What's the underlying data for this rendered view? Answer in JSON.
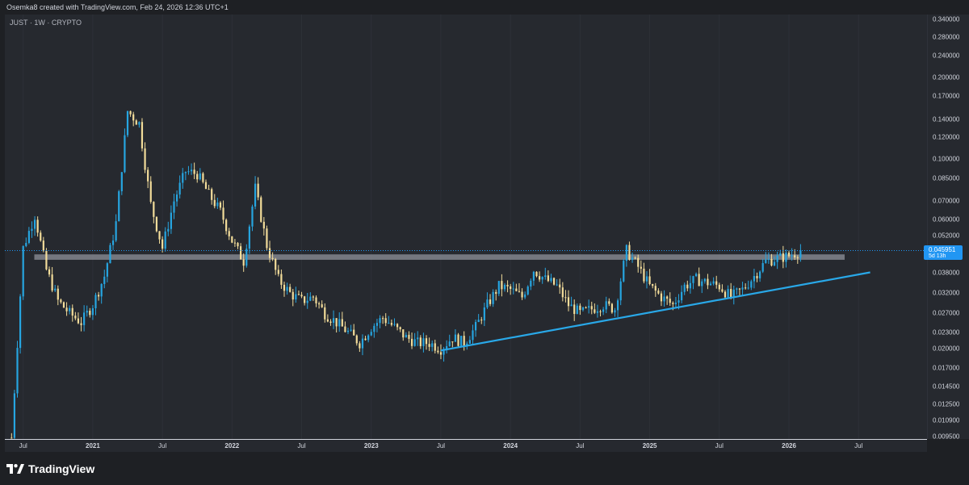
{
  "header": {
    "text": "Osemka8 created with TradingView.com, Feb 24, 2026 12:36 UTC+1"
  },
  "chart": {
    "symbol_label": "JUST · 1W · CRYPTO",
    "colors": {
      "up": "#26a5e0",
      "down": "#f2dc9a",
      "resistance_zone": "#9598a1",
      "trendline": "#29a8e8",
      "price_line": "#2196f3"
    },
    "price_badge": {
      "value": "0.045951",
      "countdown": "5d 13h"
    }
  },
  "price_axis": {
    "ticks": [
      "0.340000",
      "0.280000",
      "0.240000",
      "0.200000",
      "0.170000",
      "0.140000",
      "0.120000",
      "0.100000",
      "0.085000",
      "0.070000",
      "0.060000",
      "0.052000",
      "0.038000",
      "0.032000",
      "0.027000",
      "0.023000",
      "0.020000",
      "0.017000",
      "0.014500",
      "0.012500",
      "0.010900",
      "0.009500"
    ]
  },
  "time_axis": {
    "ticks": [
      "Jul",
      "2021",
      "Jul",
      "2022",
      "Jul",
      "2023",
      "Jul",
      "2024",
      "Jul",
      "2025",
      "Jul",
      "2026",
      "Jul"
    ]
  },
  "footer": {
    "logo_text": "TradingView",
    "logo_icon": "tradingview-logo-icon"
  },
  "chart_data": {
    "type": "candlestick",
    "title": "JUST · 1W · CRYPTO",
    "scale": "log",
    "ylim": [
      0.0093,
      0.34
    ],
    "last_price": 0.045951,
    "resistance_zone": [
      0.0425,
      0.0445
    ],
    "trendline": {
      "from": [
        "2023-07",
        0.0197
      ],
      "to": [
        "2026-08",
        0.0382
      ]
    },
    "series": [
      {
        "name": "JUST",
        "x": [
          "2020-06",
          "2020-07",
          "2020-08",
          "2020-09",
          "2020-10",
          "2020-11",
          "2020-12",
          "2021-01",
          "2021-02",
          "2021-03",
          "2021-04",
          "2021-05",
          "2021-06",
          "2021-07",
          "2021-08",
          "2021-09",
          "2021-10",
          "2021-11",
          "2021-12",
          "2022-01",
          "2022-02",
          "2022-03",
          "2022-04",
          "2022-05",
          "2022-06",
          "2022-07",
          "2022-08",
          "2022-09",
          "2022-10",
          "2022-11",
          "2022-12",
          "2023-01",
          "2023-02",
          "2023-03",
          "2023-04",
          "2023-05",
          "2023-06",
          "2023-07",
          "2023-08",
          "2023-09",
          "2023-10",
          "2023-11",
          "2023-12",
          "2024-01",
          "2024-02",
          "2024-03",
          "2024-04",
          "2024-05",
          "2024-06",
          "2024-07",
          "2024-08",
          "2024-09",
          "2024-10",
          "2024-11",
          "2024-12",
          "2025-01",
          "2025-02",
          "2025-03",
          "2025-04",
          "2025-05",
          "2025-06",
          "2025-07",
          "2025-08",
          "2025-09",
          "2025-10",
          "2025-11",
          "2025-12",
          "2026-01",
          "2026-02"
        ],
        "close": [
          0.0094,
          0.047,
          0.062,
          0.039,
          0.03,
          0.027,
          0.025,
          0.029,
          0.037,
          0.058,
          0.15,
          0.135,
          0.068,
          0.047,
          0.07,
          0.09,
          0.088,
          0.074,
          0.064,
          0.05,
          0.042,
          0.078,
          0.048,
          0.036,
          0.032,
          0.03,
          0.031,
          0.027,
          0.025,
          0.023,
          0.021,
          0.024,
          0.026,
          0.024,
          0.022,
          0.021,
          0.021,
          0.02,
          0.022,
          0.021,
          0.024,
          0.029,
          0.034,
          0.033,
          0.031,
          0.039,
          0.036,
          0.034,
          0.029,
          0.027,
          0.028,
          0.029,
          0.028,
          0.046,
          0.04,
          0.034,
          0.031,
          0.029,
          0.034,
          0.036,
          0.035,
          0.034,
          0.031,
          0.033,
          0.037,
          0.042,
          0.043,
          0.044,
          0.046
        ]
      }
    ]
  }
}
